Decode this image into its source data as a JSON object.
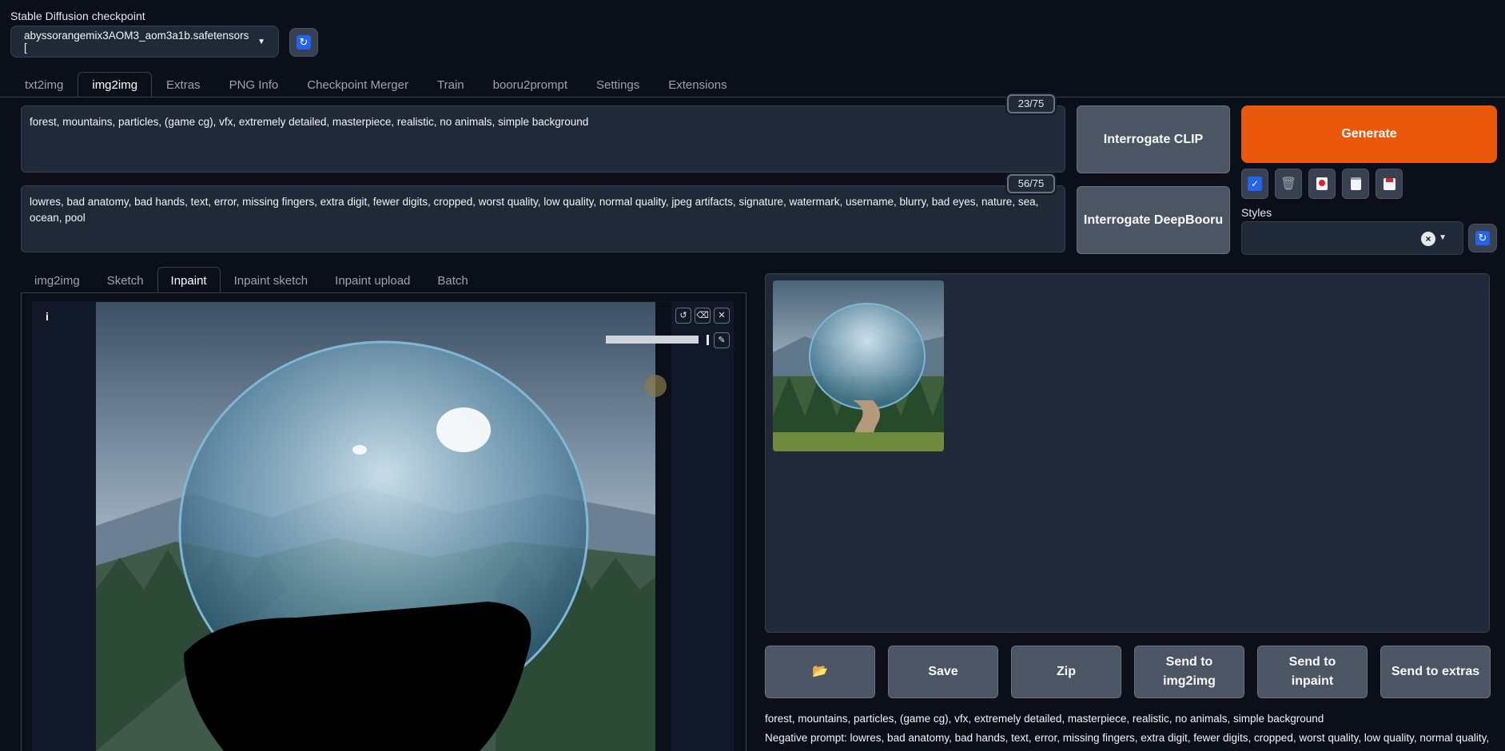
{
  "checkpoint": {
    "label": "Stable Diffusion checkpoint",
    "value": "abyssorangemix3AOM3_aom3a1b.safetensors ["
  },
  "main_tabs": [
    {
      "label": "txt2img"
    },
    {
      "label": "img2img",
      "active": true
    },
    {
      "label": "Extras"
    },
    {
      "label": "PNG Info"
    },
    {
      "label": "Checkpoint Merger"
    },
    {
      "label": "Train"
    },
    {
      "label": "booru2prompt"
    },
    {
      "label": "Settings"
    },
    {
      "label": "Extensions"
    }
  ],
  "prompt": {
    "text": "forest, mountains,  particles, (game cg), vfx, extremely detailed, masterpiece, realistic, no animals, simple background",
    "counter": "23/75"
  },
  "negative_prompt": {
    "text": "lowres, bad anatomy, bad hands, text, error, missing fingers, extra digit, fewer digits, cropped, worst quality, low quality, normal quality, jpeg artifacts, signature, watermark, username, blurry, bad eyes, nature, sea, ocean, pool",
    "counter": "56/75"
  },
  "buttons": {
    "interrogate_clip": "Interrogate CLIP",
    "interrogate_deepbooru": "Interrogate DeepBooru",
    "generate": "Generate"
  },
  "styles": {
    "label": "Styles",
    "value": ""
  },
  "sub_tabs": [
    {
      "label": "img2img"
    },
    {
      "label": "Sketch"
    },
    {
      "label": "Inpaint",
      "active": true
    },
    {
      "label": "Inpaint sketch"
    },
    {
      "label": "Inpaint upload"
    },
    {
      "label": "Batch"
    }
  ],
  "canvas": {
    "info_label": "i"
  },
  "output_buttons": {
    "folder": "📂",
    "save": "Save",
    "zip": "Zip",
    "send_img2img_1": "Send to",
    "send_img2img_2": "img2img",
    "send_inpaint_1": "Send to",
    "send_inpaint_2": "inpaint",
    "send_extras": "Send to extras"
  },
  "generation_info": {
    "prompt_line": "forest, mountains, particles, (game cg), vfx, extremely detailed, masterpiece, realistic, no animals, simple background",
    "negative_line": "Negative prompt: lowres, bad anatomy, bad hands, text, error, missing fingers, extra digit, fewer digits, cropped, worst quality, low quality, normal quality,"
  },
  "colors": {
    "background": "#0b0f19",
    "panel": "#1f2937",
    "accent_orange": "#ea580c",
    "accent_blue": "#2563eb"
  }
}
